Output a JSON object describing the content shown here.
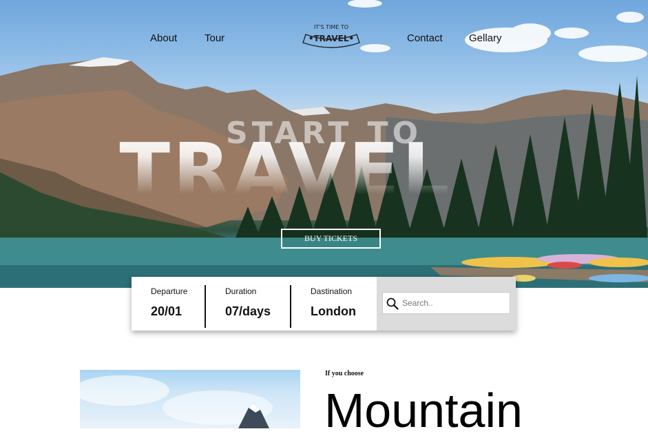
{
  "nav": {
    "left_items": [
      "About",
      "Tour"
    ],
    "right_items": [
      "Contact",
      "Gellary"
    ]
  },
  "logo": {
    "top_text": "IT'S TIME TO",
    "main_text": "•TRAVEL•"
  },
  "hero": {
    "headline_line1": "START TO",
    "headline_line2": "TRAVEL",
    "cta_label": "BUY TICKETS"
  },
  "booking": {
    "departure": {
      "label": "Departure",
      "value": "20/01"
    },
    "duration": {
      "label": "Duration",
      "value": "07/days"
    },
    "destination": {
      "label": "Dastination",
      "value": "London"
    },
    "search_placeholder": "Search.."
  },
  "section": {
    "kicker": "If you choose",
    "title": "Mountain"
  },
  "icons": {
    "search": "search-icon"
  },
  "colors": {
    "sky": "#8dbbe6",
    "lake": "#2c6f77",
    "forest": "#1f3d2c",
    "search_bg": "#dcdcdc"
  }
}
